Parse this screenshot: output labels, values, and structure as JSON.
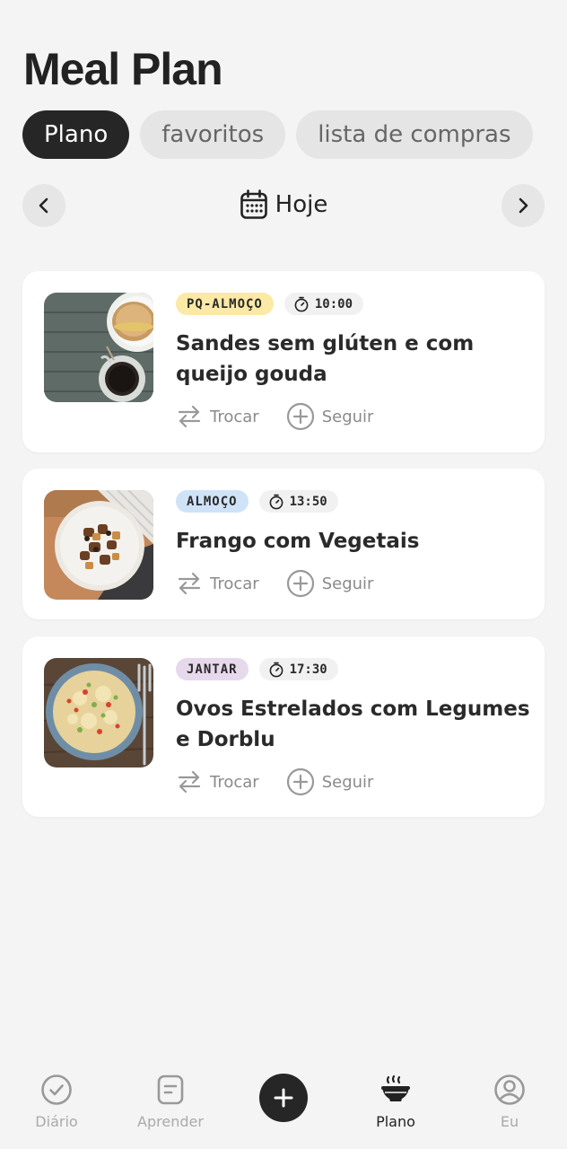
{
  "header": {
    "title": "Meal Plan"
  },
  "tabs": [
    {
      "label": "Plano",
      "active": true
    },
    {
      "label": "favoritos",
      "active": false
    },
    {
      "label": "lista de compras",
      "active": false
    }
  ],
  "date_nav": {
    "label": "Hoje"
  },
  "meals": [
    {
      "category": "PQ-ALMOÇO",
      "category_color": "#fbe9a6",
      "time": "10:00",
      "name": "Sandes sem glúten e com queijo gouda",
      "swap_label": "Trocar",
      "follow_label": "Seguir",
      "image": "sandwich-coffee"
    },
    {
      "category": "ALMOÇO",
      "category_color": "#cfe3f8",
      "time": "13:50",
      "name": "Frango com Vegetais",
      "swap_label": "Trocar",
      "follow_label": "Seguir",
      "image": "chicken-vegetables"
    },
    {
      "category": "JANTAR",
      "category_color": "#e7d9ec",
      "time": "17:30",
      "name": "Ovos Estrelados com Legumes e Dorblu",
      "swap_label": "Trocar",
      "follow_label": "Seguir",
      "image": "eggs-vegetables"
    }
  ],
  "bottom_nav": [
    {
      "label": "Diário",
      "icon": "check-circle-icon",
      "active": false
    },
    {
      "label": "Aprender",
      "icon": "note-icon",
      "active": false
    },
    {
      "label": "",
      "icon": "plus-icon",
      "active": false
    },
    {
      "label": "Plano",
      "icon": "bowl-icon",
      "active": true
    },
    {
      "label": "Eu",
      "icon": "user-circle-icon",
      "active": false
    }
  ]
}
